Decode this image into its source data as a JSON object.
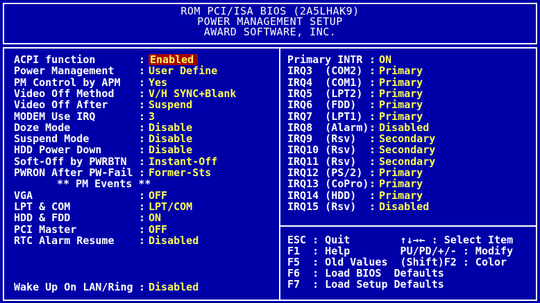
{
  "header": {
    "line1": "ROM PCI/ISA BIOS (2A5LHAK9)",
    "line2": "POWER MANAGEMENT SETUP",
    "line3": "AWARD SOFTWARE, INC."
  },
  "left_settings": [
    {
      "label": "ACPI function",
      "value": "Enabled",
      "selected": true
    },
    {
      "label": "Power Management",
      "value": "User Define"
    },
    {
      "label": "PM Control by APM",
      "value": "Yes"
    },
    {
      "label": "Video Off Method",
      "value": "V/H SYNC+Blank"
    },
    {
      "label": "Video Off After",
      "value": "Suspend"
    },
    {
      "label": "MODEM Use IRQ",
      "value": "3"
    },
    {
      "label": "Doze Mode",
      "value": "Disable"
    },
    {
      "label": "Suspend Mode",
      "value": "Disable"
    },
    {
      "label": "HDD Power Down",
      "value": "Disable"
    },
    {
      "label": "Soft-Off by PWRBTN",
      "value": "Instant-Off"
    },
    {
      "label": "PWRON After PW-Fail",
      "value": "Former-Sts"
    }
  ],
  "pm_events_heading": "** PM Events **",
  "pm_events": [
    {
      "label": "VGA",
      "value": "OFF"
    },
    {
      "label": "LPT & COM",
      "value": "LPT/COM"
    },
    {
      "label": "HDD & FDD",
      "value": "ON"
    },
    {
      "label": "PCI Master",
      "value": "OFF"
    },
    {
      "label": "RTC Alarm Resume",
      "value": "Disabled"
    }
  ],
  "wake_setting": {
    "label": "Wake Up On LAN/Ring",
    "value": "Disabled"
  },
  "right_settings": [
    {
      "label": "Primary INTR",
      "value": "ON"
    },
    {
      "label": "IRQ3  (COM2)",
      "value": "Primary"
    },
    {
      "label": "IRQ4  (COM1)",
      "value": "Primary"
    },
    {
      "label": "IRQ5  (LPT2)",
      "value": "Primary"
    },
    {
      "label": "IRQ6  (FDD)",
      "value": "Primary"
    },
    {
      "label": "IRQ7  (LPT1)",
      "value": "Primary"
    },
    {
      "label": "IRQ8  (Alarm)",
      "value": "Disabled"
    },
    {
      "label": "IRQ9  (Rsv)",
      "value": "Secondary"
    },
    {
      "label": "IRQ10 (Rsv)",
      "value": "Secondary"
    },
    {
      "label": "IRQ11 (Rsv)",
      "value": "Secondary"
    },
    {
      "label": "IRQ12 (PS/2)",
      "value": "Primary"
    },
    {
      "label": "IRQ13 (CoPro)",
      "value": "Primary"
    },
    {
      "label": "IRQ14 (HDD)",
      "value": "Primary"
    },
    {
      "label": "IRQ15 (Rsv)",
      "value": "Disabled"
    }
  ],
  "help": [
    "ESC : Quit        ↑↓→← : Select Item",
    "F1  : Help        PU/PD/+/- : Modify",
    "F5  : Old Values  (Shift)F2 : Color",
    "F6  : Load BIOS  Defaults",
    "F7  : Load Setup Defaults"
  ],
  "colors": {
    "background": "#0000a8",
    "label": "#ffffff",
    "value": "#ffff55",
    "selection": "#a80000"
  }
}
